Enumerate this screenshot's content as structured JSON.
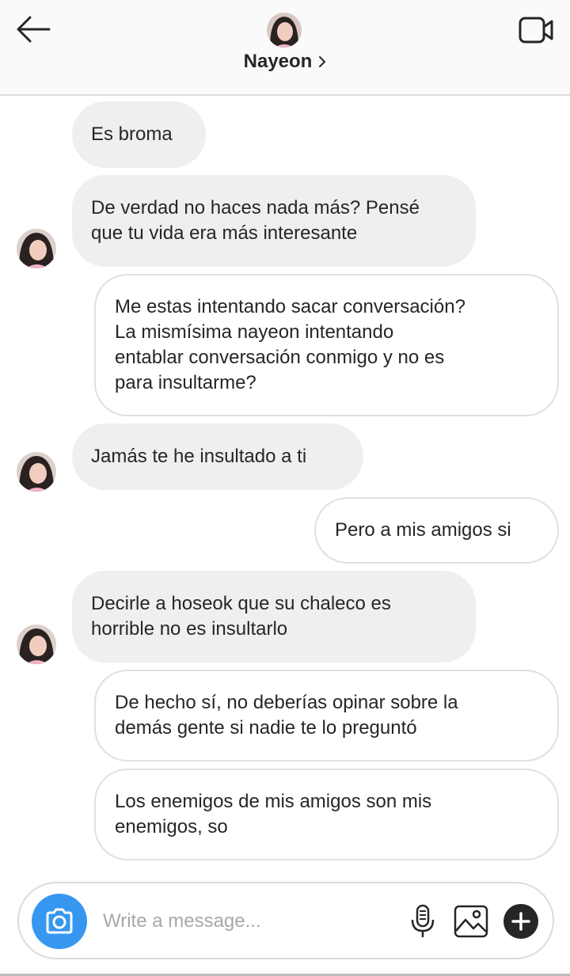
{
  "header": {
    "contact_name": "Nayeon",
    "back_icon": "arrow-left-icon",
    "video_icon": "video-camera-icon",
    "chevron_icon": "chevron-right-icon"
  },
  "messages": [
    {
      "sender": "them",
      "show_avatar": false,
      "lines": [
        "Es broma"
      ]
    },
    {
      "sender": "them",
      "show_avatar": true,
      "lines": [
        "De verdad no haces nada más? Pensé",
        "que tu vida era más interesante"
      ]
    },
    {
      "sender": "me",
      "lines": [
        "Me estas intentando sacar conversación?",
        "La mismísima nayeon intentando",
        "entablar conversación conmigo y no es",
        "para insultarme?"
      ]
    },
    {
      "sender": "them",
      "show_avatar": true,
      "lines": [
        "Jamás te he insultado a ti"
      ]
    },
    {
      "sender": "me",
      "lines": [
        "Pero a mis amigos si"
      ]
    },
    {
      "sender": "them",
      "show_avatar": true,
      "lines": [
        "Decirle a hoseok que su chaleco es",
        "horrible no es insultarlo"
      ]
    },
    {
      "sender": "me",
      "lines": [
        "De hecho sí, no deberías opinar sobre la",
        "demás gente si nadie te lo preguntó"
      ]
    },
    {
      "sender": "me",
      "lines": [
        "Los enemigos de mis amigos son mis",
        "enemigos, so"
      ]
    }
  ],
  "composer": {
    "placeholder": "Write a message...",
    "value": "",
    "camera_icon": "camera-icon",
    "mic_icon": "microphone-icon",
    "gallery_icon": "image-gallery-icon",
    "plus_icon": "plus-circle-icon"
  },
  "colors": {
    "accent": "#3797f0",
    "incoming_bubble": "#efefef",
    "outgoing_border": "#e0e0e0",
    "text": "#262626",
    "placeholder": "#a8a8a8"
  }
}
